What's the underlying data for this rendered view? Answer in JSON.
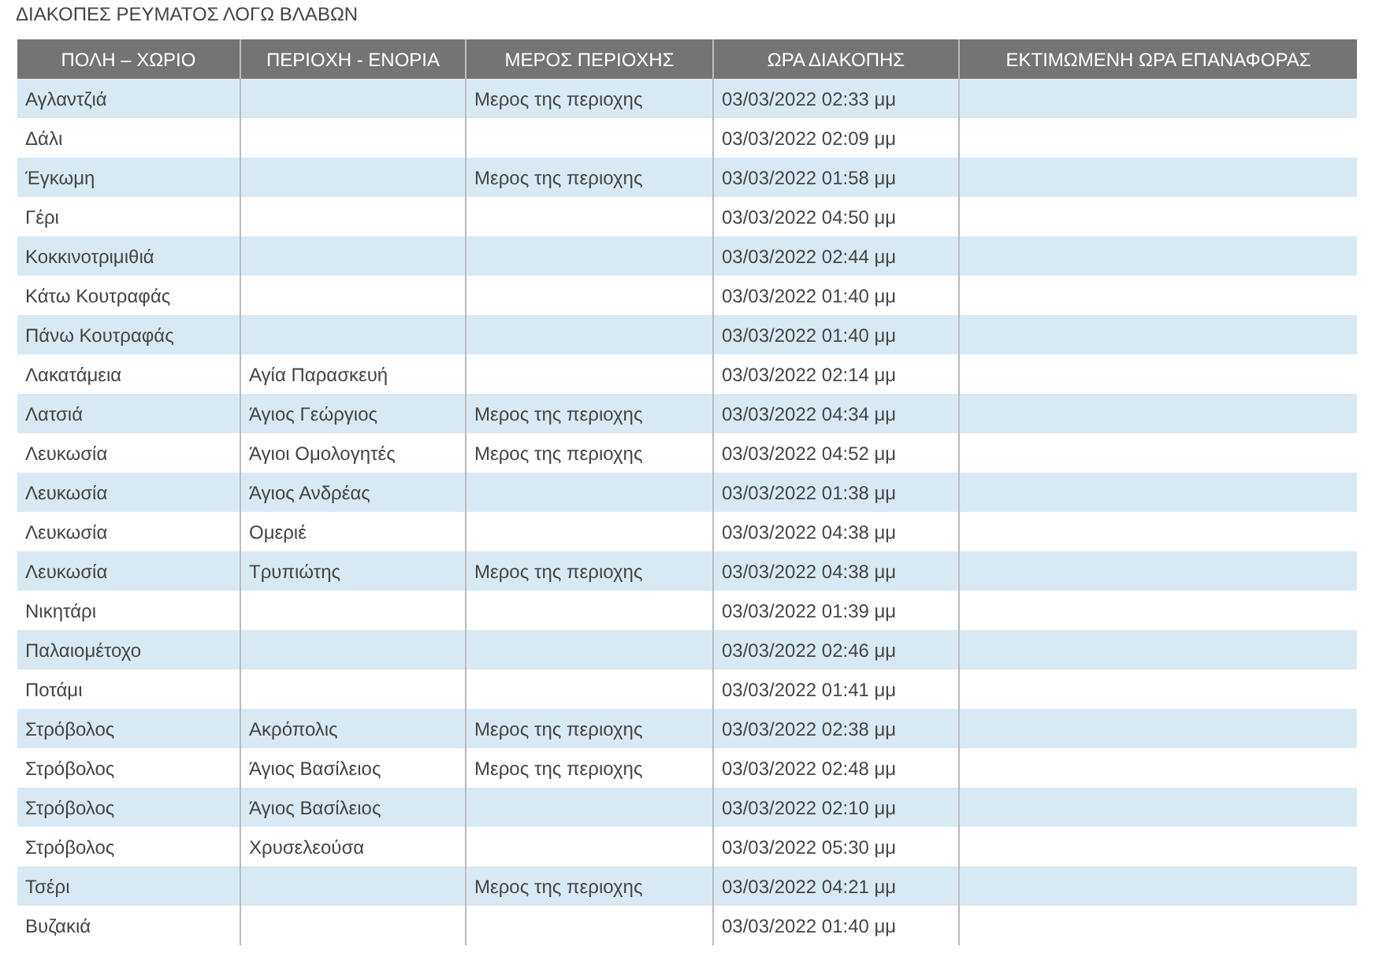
{
  "title": "ΔΙΑΚΟΠΕΣ ΡΕΥΜΑΤΟΣ ΛΟΓΩ ΒΛΑΒΩΝ",
  "table": {
    "columns": [
      "ΠΟΛΗ – ΧΩΡΙΟ",
      "ΠΕΡΙΟΧΗ - ΕΝΟΡΙΑ",
      "ΜΕΡΟΣ ΠΕΡΙΟΧΗΣ",
      "ΩΡΑ ΔΙΑΚΟΠΗΣ",
      "ΕΚΤΙΜΩΜΕΝΗ ΩΡΑ ΕΠΑΝΑΦΟΡΑΣ"
    ],
    "rows": [
      {
        "city": "Αγλαντζιά",
        "part": "Μερος της περιοχης",
        "outage_time": "03/03/2022 02:33 μμ"
      },
      {
        "city": "Δάλι",
        "outage_time": "03/03/2022 02:09 μμ"
      },
      {
        "city": "Έγκωμη",
        "part": "Μερος της περιοχης",
        "outage_time": "03/03/2022 01:58 μμ"
      },
      {
        "city": "Γέρι",
        "outage_time": "03/03/2022 04:50 μμ"
      },
      {
        "city": "Κοκκινοτριμιθιά",
        "outage_time": "03/03/2022 02:44 μμ"
      },
      {
        "city": "Κάτω Κουτραφάς",
        "outage_time": "03/03/2022 01:40 μμ"
      },
      {
        "city": "Πάνω Κουτραφάς",
        "outage_time": "03/03/2022 01:40 μμ"
      },
      {
        "city": "Λακατάμεια",
        "area": "Αγία Παρασκευή",
        "outage_time": "03/03/2022 02:14 μμ"
      },
      {
        "city": "Λατσιά",
        "area": "Άγιος Γεώργιος",
        "part": "Μερος της περιοχης",
        "outage_time": "03/03/2022 04:34 μμ"
      },
      {
        "city": "Λευκωσία",
        "area": "Άγιοι Ομολογητές",
        "part": "Μερος της περιοχης",
        "outage_time": "03/03/2022 04:52 μμ"
      },
      {
        "city": "Λευκωσία",
        "area": "Άγιος Ανδρέας",
        "outage_time": "03/03/2022 01:38 μμ"
      },
      {
        "city": "Λευκωσία",
        "area": "Ομεριέ",
        "outage_time": "03/03/2022 04:38 μμ"
      },
      {
        "city": "Λευκωσία",
        "area": "Τρυπιώτης",
        "part": "Μερος της περιοχης",
        "outage_time": "03/03/2022 04:38 μμ"
      },
      {
        "city": "Νικητάρι",
        "outage_time": "03/03/2022 01:39 μμ"
      },
      {
        "city": "Παλαιομέτοχο",
        "outage_time": "03/03/2022 02:46 μμ"
      },
      {
        "city": "Ποτάμι",
        "outage_time": "03/03/2022 01:41 μμ"
      },
      {
        "city": "Στρόβολος",
        "area": "Ακρόπολις",
        "part": "Μερος της περιοχης",
        "outage_time": "03/03/2022 02:38 μμ"
      },
      {
        "city": "Στρόβολος",
        "area": "Άγιος Βασίλειος",
        "part": "Μερος της περιοχης",
        "outage_time": "03/03/2022 02:48 μμ"
      },
      {
        "city": "Στρόβολος",
        "area": "Άγιος Βασίλειος",
        "outage_time": "03/03/2022 02:10 μμ"
      },
      {
        "city": "Στρόβολος",
        "area": "Χρυσελεούσα",
        "outage_time": "03/03/2022 05:30 μμ"
      },
      {
        "city": "Τσέρι",
        "part": "Μερος της περιοχης",
        "outage_time": "03/03/2022 04:21 μμ"
      },
      {
        "city": "Βυζακιά",
        "outage_time": "03/03/2022 01:40 μμ"
      }
    ]
  }
}
